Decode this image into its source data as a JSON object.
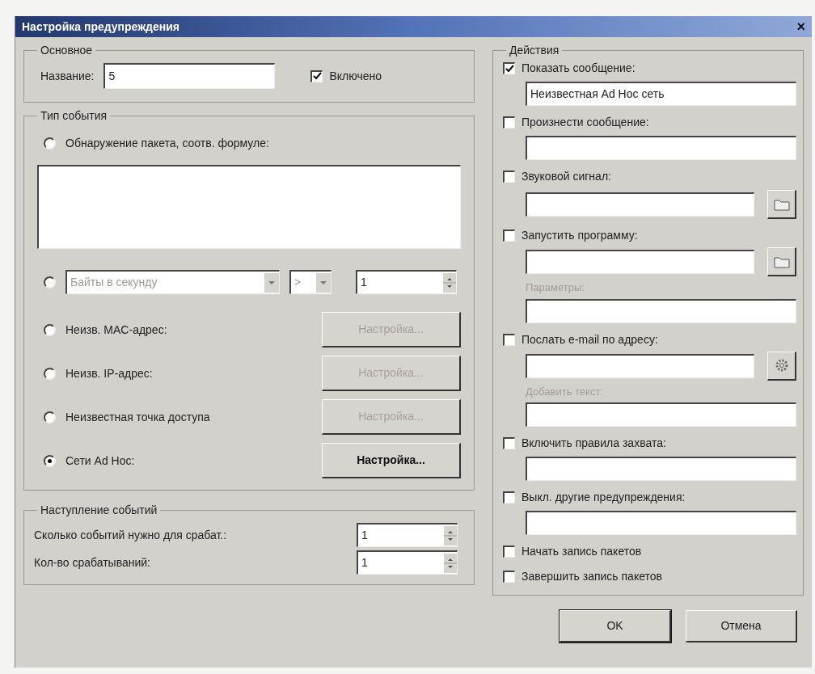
{
  "window": {
    "title": "Настройка предупреждения",
    "close": "×"
  },
  "general": {
    "title": "Основное",
    "name_label": "Название:",
    "name_value": "5",
    "enabled": {
      "label": "Включено",
      "checked": true
    }
  },
  "event_type": {
    "title": "Тип события",
    "options": [
      {
        "kind": "formula",
        "label": "Обнаружение пакета, соотв. формуле:",
        "selected": false
      },
      {
        "kind": "rate",
        "selected": false,
        "disabled": true,
        "metric": "Байты в секунду",
        "operator": ">",
        "value": "1"
      },
      {
        "kind": "setup",
        "label": "Неизв. MAC-адрес:",
        "selected": false,
        "button": {
          "label": "Настройка...",
          "disabled": true
        }
      },
      {
        "kind": "setup",
        "label": "Неизв. IP-адрес:",
        "selected": false,
        "button": {
          "label": "Настройка...",
          "disabled": true
        }
      },
      {
        "kind": "setup",
        "label": "Неизвестная точка доступа",
        "selected": false,
        "button": {
          "label": "Настройка...",
          "disabled": true
        }
      },
      {
        "kind": "setup",
        "label": "Сети Ad Hoc:",
        "selected": true,
        "button": {
          "label": "Настройка...",
          "disabled": false
        }
      }
    ]
  },
  "occurrence": {
    "title": "Наступление событий",
    "rows": [
      {
        "label": "Сколько событий нужно для срабат.:",
        "value": "1"
      },
      {
        "label": "Кол-во срабатываний:",
        "value": "1"
      }
    ]
  },
  "actions": {
    "title": "Действия",
    "items": [
      {
        "kind": "field",
        "label": "Показать сообщение:",
        "checked": true,
        "value": "Неизвестная Ad Hoc сеть"
      },
      {
        "kind": "field",
        "label": "Произнести сообщение:",
        "checked": false
      },
      {
        "kind": "file",
        "label": "Звуковой сигнал:",
        "checked": false
      },
      {
        "kind": "program",
        "label": "Запустить программу:",
        "checked": false,
        "sub_label": {
          "text": "Параметры:",
          "disabled": true
        }
      },
      {
        "kind": "email",
        "label": "Послать e-mail по адресу:",
        "checked": false,
        "sub_label": {
          "text": "Добавить текст:",
          "disabled": true
        }
      },
      {
        "kind": "field",
        "label": "Включить правила захвата:",
        "checked": false
      },
      {
        "kind": "field",
        "label": "Выкл. другие предупреждения:",
        "checked": false
      },
      {
        "kind": "plain",
        "label": "Начать запись пакетов",
        "checked": false
      },
      {
        "kind": "plain",
        "label": "Завершить запись пакетов",
        "checked": false
      }
    ]
  },
  "buttons": [
    {
      "label": "OK",
      "default": true
    },
    {
      "label": "Отмена",
      "default": false
    }
  ]
}
